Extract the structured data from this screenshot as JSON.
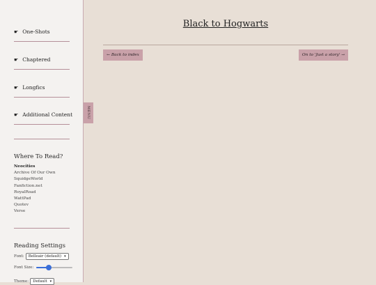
{
  "sidebar": {
    "nav": [
      {
        "icon": "pointing-hand-icon",
        "label": "One-Shots"
      },
      {
        "icon": "pointing-hand-icon",
        "label": "Chaptered"
      },
      {
        "icon": "pointing-hand-icon",
        "label": "Longfics"
      },
      {
        "icon": "pointing-hand-icon",
        "label": "Additional Content"
      }
    ],
    "hand_glyph": "☛",
    "where_title": "Where To Read?",
    "where_items": [
      "Neocities",
      "Archive Of Our Own",
      "SquidgeWorld",
      "Fanfiction.net",
      "RoyalRoad",
      "WattPad",
      "Quotev",
      "Verse"
    ],
    "settings_title": "Reading Settings",
    "font_label": "Font:",
    "font_value": "Belleair (default)",
    "font_size_label": "Font Size:",
    "font_size_level": 0.3,
    "theme_label": "Theme:",
    "theme_value": "Default"
  },
  "menu_tab": {
    "label": "MENU"
  },
  "main": {
    "title": "Black to Hogwarts",
    "back_button": "← Back to index",
    "next_button": "On to 'Just a story' →"
  },
  "colors": {
    "accent": "#c9a1a9",
    "background": "#e8dfd6",
    "sidebar": "#f4f2f0",
    "slider": "#3b6fd8"
  }
}
